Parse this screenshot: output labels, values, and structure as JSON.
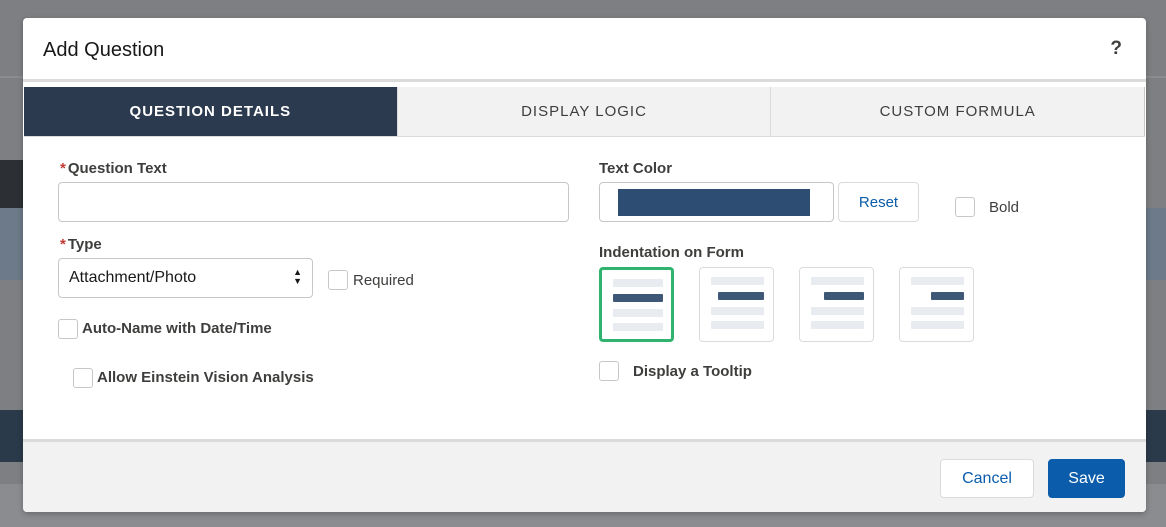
{
  "modal": {
    "title": "Add Question",
    "help_glyph": "?"
  },
  "tabs": [
    {
      "label": "QUESTION DETAILS",
      "active": true
    },
    {
      "label": "DISPLAY LOGIC",
      "active": false
    },
    {
      "label": "CUSTOM FORMULA",
      "active": false
    }
  ],
  "form": {
    "question_text": {
      "required_mark": "*",
      "label": "Question Text",
      "value": ""
    },
    "type": {
      "required_mark": "*",
      "label": "Type",
      "value": "Attachment/Photo"
    },
    "required_checkbox": {
      "label": "Required",
      "checked": false
    },
    "auto_name_checkbox": {
      "label": "Auto-Name with Date/Time",
      "checked": false
    },
    "einstein_checkbox": {
      "label": "Allow Einstein Vision Analysis",
      "checked": false
    },
    "text_color": {
      "label": "Text Color",
      "value": "#2d4e72",
      "reset_label": "Reset"
    },
    "bold_checkbox": {
      "label": "Bold",
      "checked": false
    },
    "indentation": {
      "label": "Indentation on Form",
      "selected_index": 0
    },
    "tooltip_checkbox": {
      "label": "Display a Tooltip",
      "checked": false
    }
  },
  "footer": {
    "cancel_label": "Cancel",
    "save_label": "Save"
  },
  "colors": {
    "active_tab": "#2b3a4f",
    "brand": "#0b5cab",
    "selected_indent": "#2fb36f",
    "required": "#c23934"
  }
}
